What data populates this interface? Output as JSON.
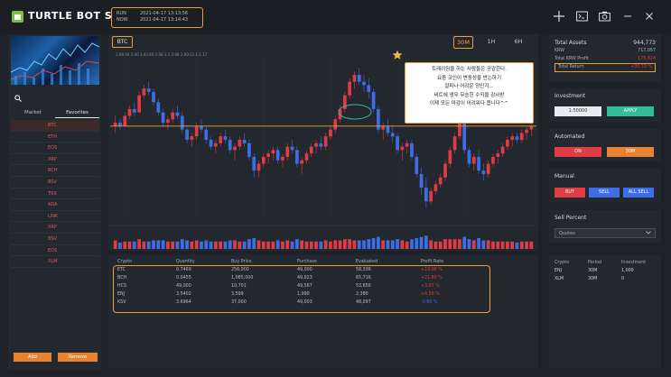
{
  "app": {
    "title": "TURTLE BOT S"
  },
  "times": [
    {
      "key": "RUN",
      "value": "2021-04-17 13:13:56"
    },
    {
      "key": "NOW",
      "value": "2021-04-17 13:14:43"
    }
  ],
  "header_icons": [
    "crosshair-icon",
    "terminal-icon",
    "camera-icon",
    "minimize-icon",
    "close-icon"
  ],
  "sidebar": {
    "tabs": [
      "Market",
      "Favorites"
    ],
    "coins": [
      "BTC",
      "ETH",
      "EOS",
      "XRP",
      "BCH",
      "BSV",
      "TRX",
      "ADA",
      "LINK",
      "XRP",
      "BSV",
      "EOS",
      "XLM"
    ],
    "add_label": "Add",
    "remove_label": "Remove"
  },
  "chart": {
    "symbol": "BTC",
    "timeframes": [
      "30M",
      "1H",
      "6H"
    ],
    "active_timeframe": "30M",
    "legend": "1:00:04 1:00  1:43:60  1:38 1:1  1:98  2:00:11  1:1.17",
    "annotation": [
      "트레이딩을 하는 사람들은 공감한다.",
      "요즘 코인이 변동성을 반는하기",
      "알파나 어려운 양인지...",
      "비트에 생무 무승헌 수익을 감사받",
      "이제 모든 마감이 어려워다 봅니다^^"
    ],
    "colors": {
      "up": "#e03c44",
      "down": "#3d6ee8",
      "line": "#e8a13a"
    }
  },
  "chart_data": {
    "type": "candlestick",
    "candles": [
      [
        60,
        63,
        58,
        61
      ],
      [
        61,
        62,
        59,
        60
      ],
      [
        60,
        64,
        60,
        63
      ],
      [
        63,
        66,
        62,
        65
      ],
      [
        65,
        67,
        63,
        64
      ],
      [
        64,
        70,
        64,
        69
      ],
      [
        69,
        72,
        68,
        71
      ],
      [
        71,
        73,
        69,
        70
      ],
      [
        70,
        71,
        66,
        67
      ],
      [
        67,
        68,
        63,
        64
      ],
      [
        64,
        65,
        60,
        61
      ],
      [
        61,
        63,
        59,
        62
      ],
      [
        62,
        65,
        61,
        64
      ],
      [
        64,
        66,
        62,
        63
      ],
      [
        63,
        64,
        58,
        59
      ],
      [
        59,
        60,
        55,
        56
      ],
      [
        56,
        58,
        54,
        57
      ],
      [
        57,
        61,
        56,
        60
      ],
      [
        60,
        62,
        58,
        59
      ],
      [
        59,
        60,
        55,
        56
      ],
      [
        56,
        57,
        53,
        54
      ],
      [
        54,
        56,
        52,
        55
      ],
      [
        55,
        58,
        54,
        57
      ],
      [
        57,
        59,
        55,
        56
      ],
      [
        56,
        57,
        52,
        53
      ],
      [
        53,
        55,
        50,
        54
      ],
      [
        54,
        57,
        53,
        56
      ],
      [
        56,
        58,
        54,
        55
      ],
      [
        55,
        56,
        50,
        51
      ],
      [
        51,
        52,
        45,
        47
      ],
      [
        47,
        50,
        45,
        49
      ],
      [
        49,
        52,
        48,
        51
      ],
      [
        51,
        53,
        49,
        52
      ],
      [
        52,
        54,
        50,
        53
      ],
      [
        53,
        54,
        49,
        50
      ],
      [
        50,
        52,
        48,
        51
      ],
      [
        51,
        55,
        50,
        54
      ],
      [
        54,
        56,
        52,
        53
      ],
      [
        53,
        54,
        48,
        49
      ],
      [
        49,
        51,
        46,
        50
      ],
      [
        50,
        53,
        49,
        52
      ],
      [
        52,
        55,
        51,
        54
      ],
      [
        54,
        56,
        52,
        55
      ],
      [
        55,
        57,
        53,
        54
      ],
      [
        54,
        58,
        53,
        57
      ],
      [
        57,
        60,
        56,
        59
      ],
      [
        59,
        63,
        58,
        62
      ],
      [
        62,
        66,
        61,
        65
      ],
      [
        65,
        70,
        64,
        69
      ],
      [
        69,
        74,
        68,
        73
      ],
      [
        73,
        76,
        71,
        75
      ],
      [
        75,
        77,
        72,
        73
      ],
      [
        73,
        75,
        70,
        72
      ],
      [
        72,
        74,
        68,
        70
      ],
      [
        70,
        71,
        64,
        65
      ],
      [
        65,
        66,
        58,
        59
      ],
      [
        59,
        61,
        56,
        60
      ],
      [
        60,
        62,
        57,
        58
      ],
      [
        58,
        60,
        55,
        57
      ],
      [
        57,
        58,
        52,
        53
      ],
      [
        53,
        55,
        50,
        54
      ],
      [
        54,
        56,
        52,
        55
      ],
      [
        55,
        56,
        50,
        51
      ],
      [
        51,
        52,
        45,
        46
      ],
      [
        46,
        48,
        40,
        42
      ],
      [
        42,
        45,
        36,
        38
      ],
      [
        38,
        42,
        37,
        41
      ],
      [
        41,
        44,
        40,
        43
      ],
      [
        43,
        46,
        42,
        45
      ],
      [
        45,
        50,
        44,
        49
      ],
      [
        49,
        54,
        48,
        53
      ],
      [
        53,
        58,
        52,
        57
      ],
      [
        57,
        62,
        56,
        61
      ],
      [
        61,
        60,
        52,
        53
      ],
      [
        53,
        54,
        48,
        49
      ],
      [
        49,
        52,
        47,
        51
      ],
      [
        51,
        53,
        46,
        47
      ],
      [
        47,
        49,
        44,
        46
      ],
      [
        46,
        50,
        45,
        49
      ],
      [
        49,
        52,
        48,
        51
      ],
      [
        51,
        53,
        49,
        52
      ],
      [
        52,
        55,
        51,
        54
      ],
      [
        54,
        57,
        53,
        56
      ],
      [
        56,
        58,
        54,
        57
      ],
      [
        57,
        58,
        55,
        56
      ],
      [
        56,
        59,
        55,
        58
      ],
      [
        58,
        60,
        56,
        59
      ],
      [
        59,
        61,
        57,
        60
      ]
    ],
    "reference_line": 60,
    "ylim": [
      32,
      80
    ]
  },
  "table": {
    "headers": [
      "Crypto",
      "Quantity",
      "Buy Price",
      "Purchase",
      "Evaluated",
      "Profit Rate"
    ],
    "rows": [
      {
        "cells": [
          "ETC",
          "0.7469",
          "256,000",
          "49,000",
          "58,336",
          "+19.06 %"
        ],
        "profit_color": "#e03c44"
      },
      {
        "cells": [
          "BCH",
          "0.0455",
          "1,085,000",
          "49,023",
          "65,716",
          "+21.80 %"
        ],
        "profit_color": "#e03c44"
      },
      {
        "cells": [
          "HCS",
          "49,000",
          "10,701",
          "49,567",
          "53,656",
          "+3.67 %"
        ],
        "profit_color": "#e03c44"
      },
      {
        "cells": [
          "ENJ",
          "3.5402",
          "3,599",
          "1,990",
          "2,380",
          "+4.56 %"
        ],
        "profit_color": "#e03c44"
      },
      {
        "cells": [
          "KSV",
          "3.6964",
          "37,000",
          "49,003",
          "48,097",
          "-0.95 %"
        ],
        "profit_color": "#3d6ee8"
      }
    ]
  },
  "assets": {
    "title": "Total Assets",
    "total": "944,773",
    "krw_label": "KRW",
    "krw_value": "717,057",
    "profit_label": "Total KRW Profit",
    "profit_value": "175,824",
    "return_label": "Total Return",
    "return_value": "+30.70 %"
  },
  "investment": {
    "title": "Investment",
    "value": "1:50000",
    "apply": "APPLY"
  },
  "automated": {
    "title": "Automated",
    "on": "ON",
    "interval": "30M"
  },
  "manual": {
    "title": "Manual",
    "buy": "BUY",
    "sell": "SELL",
    "all_sell": "ALL SELL"
  },
  "sell_percent": {
    "title": "Sell Percent",
    "value": "Quotes"
  },
  "auto_table": {
    "headers": [
      "Crypto",
      "Period",
      "Investment"
    ],
    "rows": [
      [
        "ENJ",
        "30M",
        "1,000"
      ],
      [
        "XLM",
        "30M",
        "0"
      ]
    ]
  }
}
